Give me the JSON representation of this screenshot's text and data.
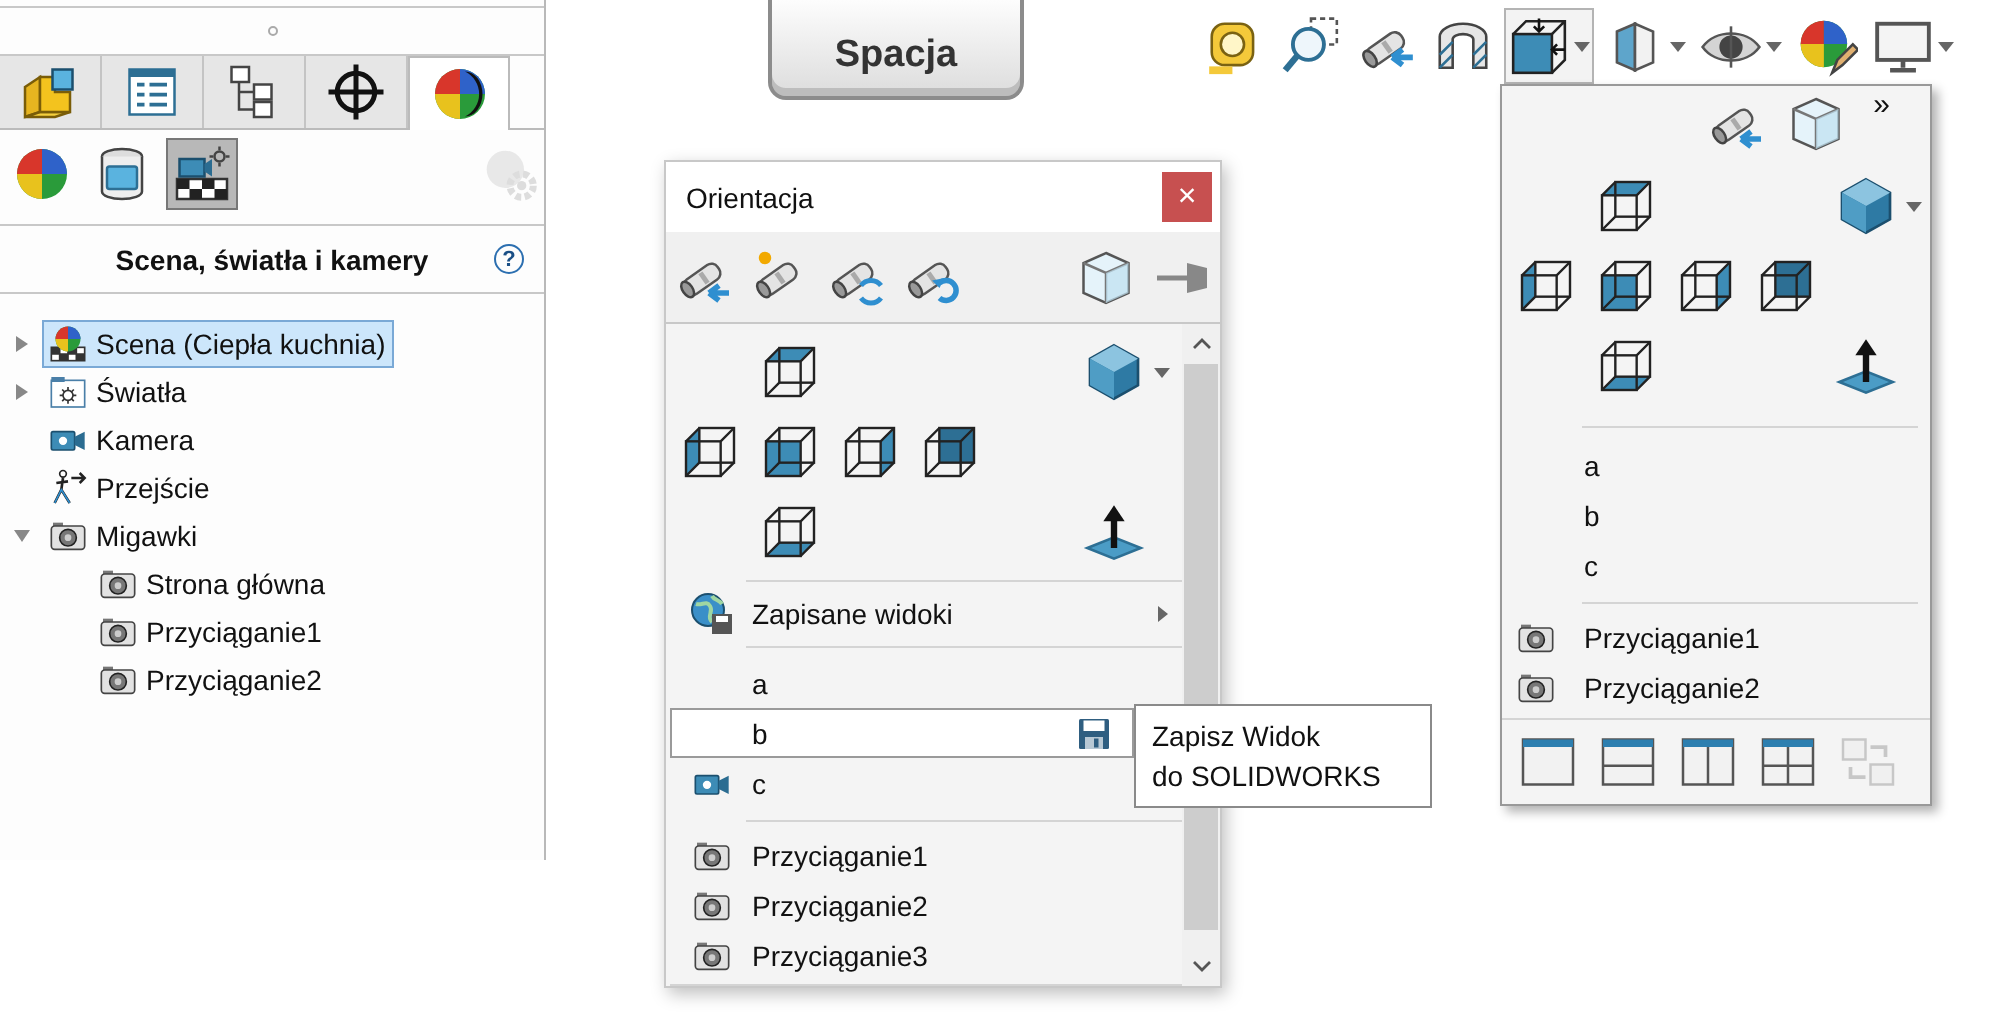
{
  "feature_manager": {
    "tabs": [
      {
        "kind": "feature_tree",
        "selected": false
      },
      {
        "kind": "property_manager",
        "selected": false
      },
      {
        "kind": "configuration_manager",
        "selected": false
      },
      {
        "kind": "dimxpert",
        "selected": false
      },
      {
        "kind": "display_manager",
        "selected": true
      }
    ],
    "subtabs": [
      {
        "kind": "appearances",
        "selected": false
      },
      {
        "kind": "decals",
        "selected": false
      },
      {
        "kind": "scene",
        "selected": true
      }
    ],
    "settings": {
      "disabled": true
    },
    "title": "Scena, światła i kamery",
    "help": "?",
    "tree": [
      {
        "label": "Scena (Ciepła kuchnia)",
        "kind": "scene",
        "expandable": true,
        "expanded": false,
        "selected": true
      },
      {
        "label": "Światła",
        "kind": "lights",
        "expandable": true,
        "expanded": false,
        "selected": false
      },
      {
        "label": "Kamera",
        "kind": "camera",
        "expandable": false,
        "selected": false
      },
      {
        "label": "Przejście",
        "kind": "walkthrough",
        "expandable": false,
        "selected": false
      },
      {
        "label": "Migawki",
        "kind": "snapshots",
        "expandable": true,
        "expanded": true,
        "selected": false,
        "children": [
          {
            "label": "Strona główna",
            "kind": "snapshot",
            "selected": false
          },
          {
            "label": "Przyciąganie1",
            "kind": "snapshot",
            "selected": false
          },
          {
            "label": "Przyciąganie2",
            "kind": "snapshot",
            "selected": false
          }
        ]
      }
    ]
  },
  "key": {
    "label": "Spacja"
  },
  "heads_up_toolbar": [
    {
      "kind": "measure",
      "dropdown": false,
      "pressed": false
    },
    {
      "kind": "zoom_area",
      "dropdown": false,
      "pressed": false
    },
    {
      "kind": "previous_view",
      "dropdown": false,
      "pressed": false
    },
    {
      "kind": "section_view",
      "dropdown": false,
      "pressed": false
    },
    {
      "kind": "view_orientation",
      "dropdown": true,
      "pressed": true
    },
    {
      "kind": "display_style",
      "dropdown": true,
      "pressed": false
    },
    {
      "kind": "hide_show",
      "dropdown": true,
      "pressed": false
    },
    {
      "kind": "edit_appearance",
      "dropdown": false,
      "pressed": false
    },
    {
      "kind": "monitor",
      "dropdown": true,
      "pressed": false
    }
  ],
  "orientation_dialog": {
    "title": "Orientacja",
    "close": "×",
    "tools": [
      {
        "kind": "new_view"
      },
      {
        "kind": "update_view"
      },
      {
        "kind": "reset_views"
      },
      {
        "kind": "undo_view"
      },
      {
        "kind": "view_selector"
      },
      {
        "kind": "pin"
      }
    ],
    "views": [
      {
        "kind": "top"
      },
      {
        "kind": "isometric"
      },
      {
        "kind": "left"
      },
      {
        "kind": "front"
      },
      {
        "kind": "right"
      },
      {
        "kind": "back"
      },
      {
        "kind": "bottom"
      },
      {
        "kind": "normal_to"
      }
    ],
    "saved_views": {
      "label": "Zapisane widoki"
    },
    "named_views": [
      {
        "label": "a",
        "kind": "plain",
        "hovered": false
      },
      {
        "label": "b",
        "kind": "plain",
        "hovered": true
      },
      {
        "label": "c",
        "kind": "camera",
        "hovered": false
      }
    ],
    "snapshots": [
      {
        "label": "Przyciąganie1"
      },
      {
        "label": "Przyciąganie2"
      },
      {
        "label": "Przyciąganie3"
      }
    ],
    "tooltip": "Zapisz Widok\ndo SOLIDWORKS"
  },
  "view_dropdown": {
    "tools": [
      {
        "kind": "new_view"
      },
      {
        "kind": "view_selector"
      }
    ],
    "more": "»",
    "views": [
      {
        "kind": "top"
      },
      {
        "kind": "isometric"
      },
      {
        "kind": "left"
      },
      {
        "kind": "front"
      },
      {
        "kind": "right"
      },
      {
        "kind": "back"
      },
      {
        "kind": "bottom"
      },
      {
        "kind": "normal_to"
      }
    ],
    "named_views": [
      {
        "label": "a"
      },
      {
        "label": "b"
      },
      {
        "label": "c"
      }
    ],
    "snapshots": [
      {
        "label": "Przyciąganie1"
      },
      {
        "label": "Przyciąganie2"
      }
    ],
    "viewports": [
      {
        "kind": "single",
        "disabled": false
      },
      {
        "kind": "two_horizontal",
        "disabled": false
      },
      {
        "kind": "two_vertical",
        "disabled": false
      },
      {
        "kind": "four",
        "disabled": false
      },
      {
        "kind": "link",
        "disabled": true
      }
    ]
  }
}
